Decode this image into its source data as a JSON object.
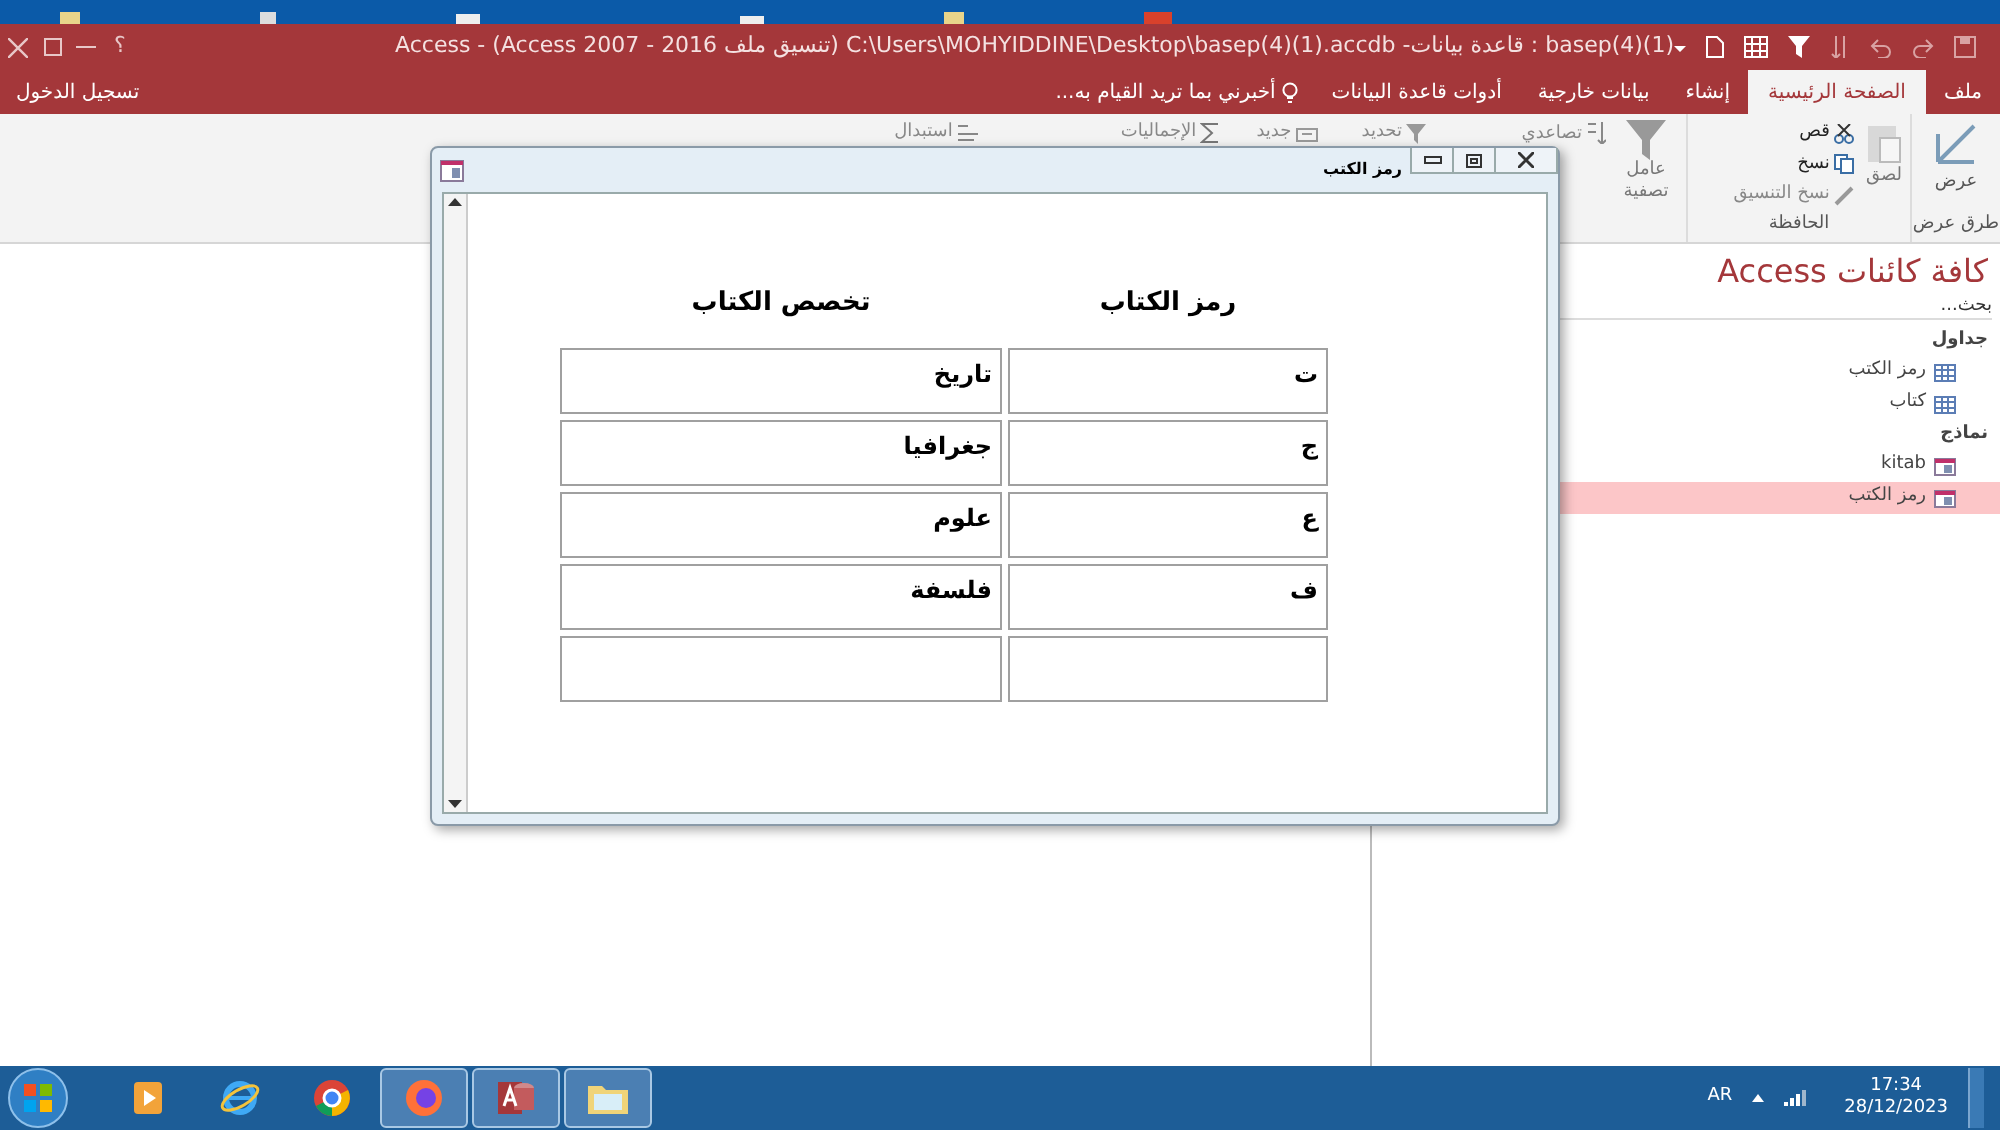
{
  "window": {
    "title": "basep(4)(1) : قاعدة بيانات- C:\\Users\\MOHYIDDINE\\Desktop\\basep(4)(1).accdb (تنسيق ملف Access 2007 - 2016) - Access",
    "help_glyph": "؟",
    "sign_in": "تسجيل الدخول"
  },
  "tabs": [
    {
      "label": "ملف",
      "selected": false
    },
    {
      "label": "الصفحة الرئيسية",
      "selected": true
    },
    {
      "label": "إنشاء",
      "selected": false
    },
    {
      "label": "بيانات خارجية",
      "selected": false
    },
    {
      "label": "أدوات قاعدة البيانات",
      "selected": false
    }
  ],
  "tell_me": "أخبرني بما تريد القيام به...",
  "ribbon": {
    "views": {
      "button": "عرض",
      "group": "طرق عرض"
    },
    "clipboard": {
      "paste": "لصق",
      "cut": "قص",
      "copy": "نسخ",
      "format_painter": "نسخ التنسيق",
      "group": "الحافظة"
    },
    "filter": {
      "button": "عامل تصفية",
      "ascending": "تصاعدي"
    },
    "top_row": [
      {
        "kind": "dropdown",
        "label": "تحديد"
      },
      {
        "kind": "button",
        "label": "جديد"
      },
      {
        "kind": "sum",
        "label": "الإجماليات"
      },
      {
        "kind": "replace",
        "label": "استبدال"
      }
    ]
  },
  "form": {
    "title": "رمز الكتب",
    "columns": [
      "رمز الكتاب",
      "تخصص الكتاب"
    ],
    "rows": [
      [
        "ت",
        "تاريخ"
      ],
      [
        "ج",
        "جغرافيا"
      ],
      [
        "ع",
        "علوم"
      ],
      [
        "ف",
        "فلسفة"
      ]
    ],
    "new_record_row": true
  },
  "nav_pane": {
    "title": "كافة كائنات Access",
    "search_placeholder": "بحث...",
    "groups": [
      {
        "label": "جداول",
        "items": [
          {
            "kind": "table",
            "label": "رمز الكتب",
            "selected": false
          },
          {
            "kind": "table",
            "label": "كتاب",
            "selected": false
          }
        ]
      },
      {
        "label": "نماذج",
        "items": [
          {
            "kind": "form",
            "label": "kitab",
            "selected": false
          },
          {
            "kind": "form",
            "label": "رمز الكتب",
            "selected": true
          }
        ]
      }
    ]
  },
  "taskbar": {
    "apps": [
      {
        "kind": "media",
        "selected": false
      },
      {
        "kind": "ie",
        "selected": false
      },
      {
        "kind": "chrome",
        "selected": false
      },
      {
        "kind": "firefox",
        "selected": true
      },
      {
        "kind": "access",
        "selected": true
      },
      {
        "kind": "explorer",
        "selected": true
      }
    ],
    "language": "AR",
    "time": "17:34",
    "date": "28/12/2023"
  }
}
